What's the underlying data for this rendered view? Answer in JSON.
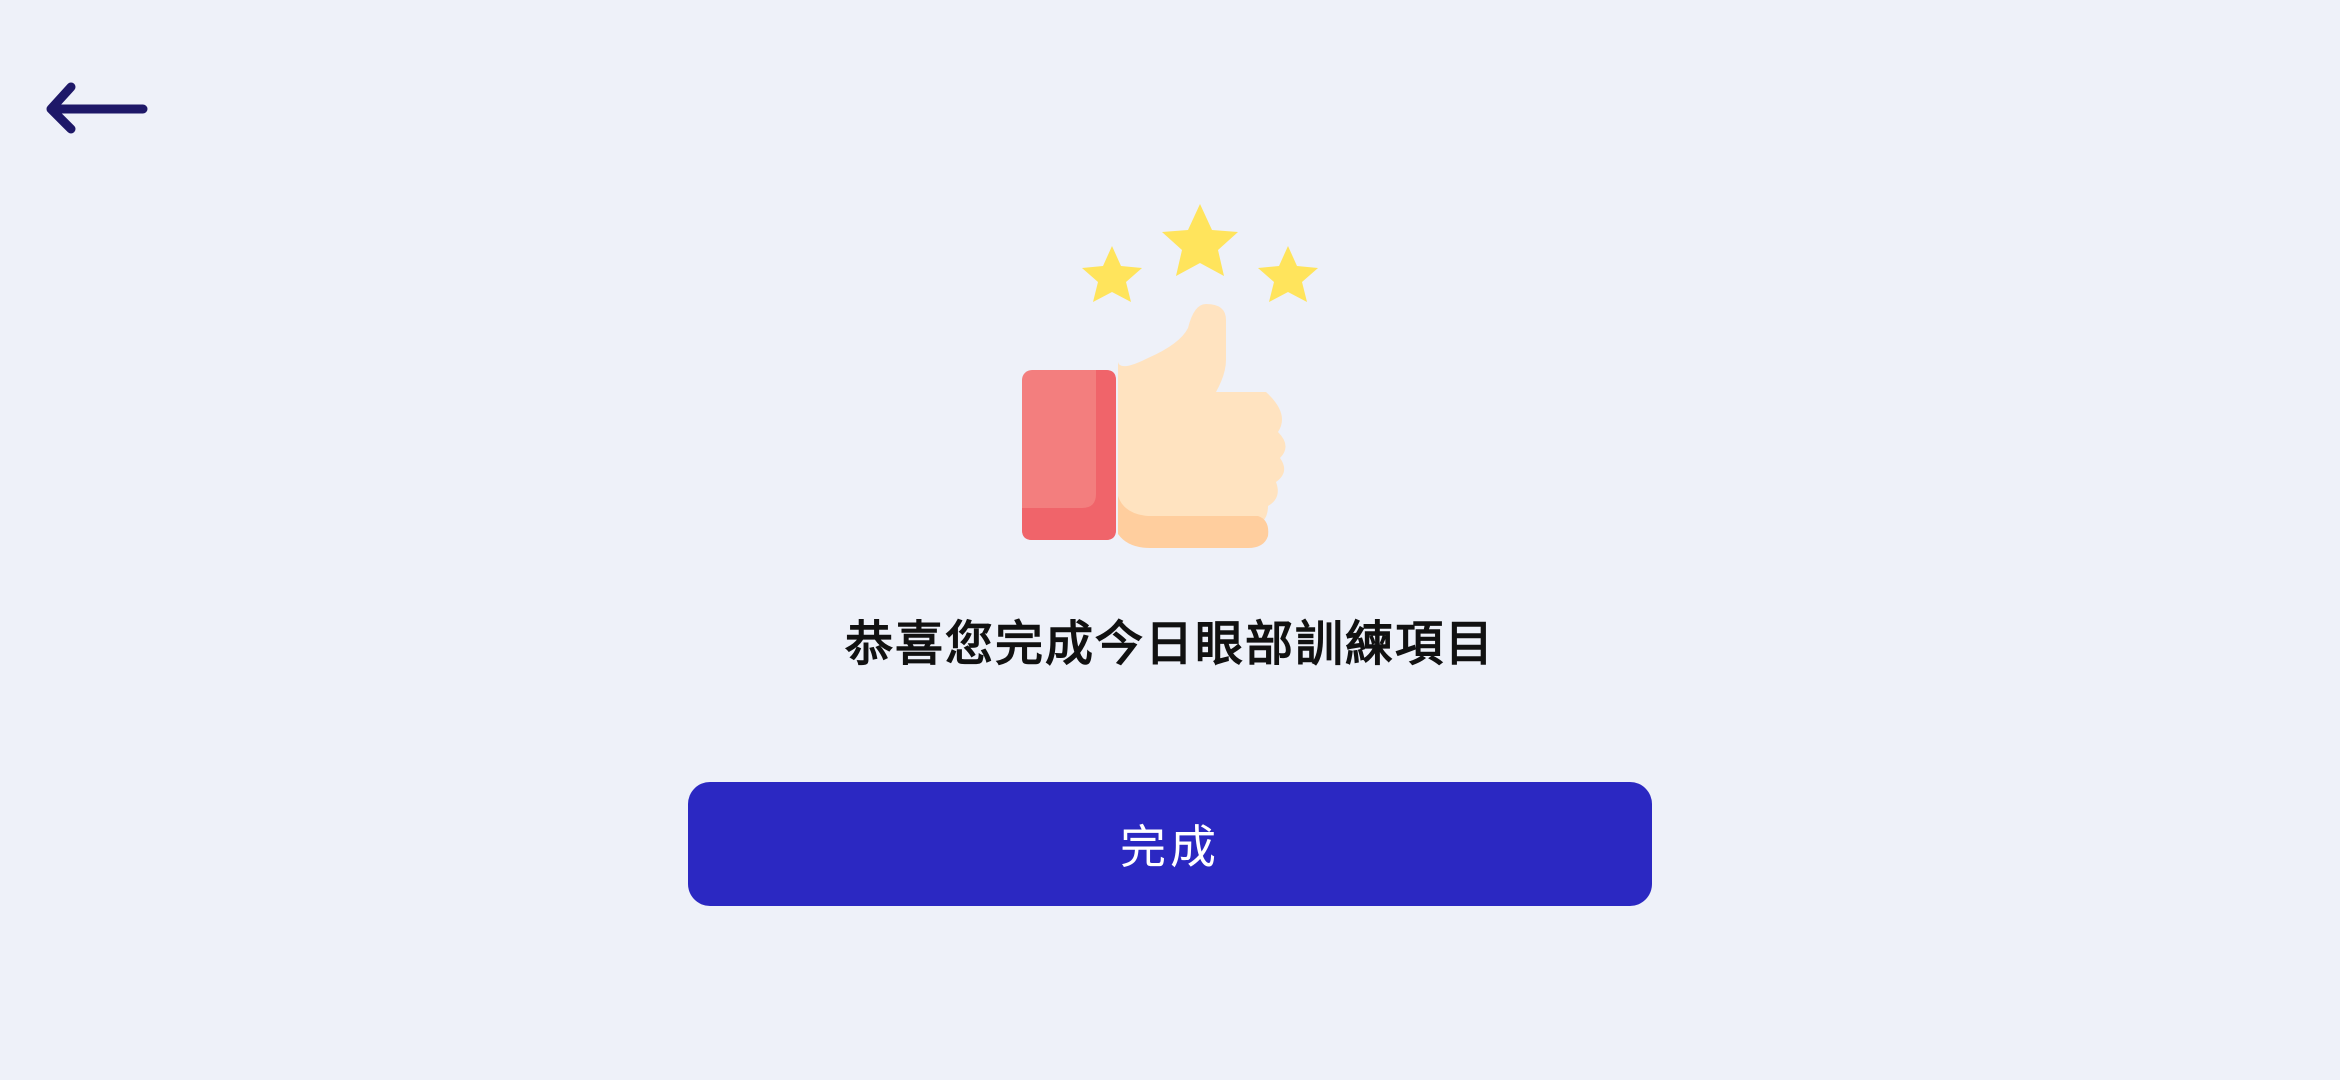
{
  "header": {
    "back_icon": "arrow-left-icon"
  },
  "illustration": {
    "icon": "thumbs-up-with-three-stars",
    "star_color": "#FFE45C",
    "cuff_color": "#F37E7E",
    "hand_color": "#FFE3C0"
  },
  "main": {
    "message": "恭喜您完成今日眼部訓練項目"
  },
  "footer": {
    "done_label": "完成",
    "done_color": "#2B28C2"
  },
  "theme": {
    "background": "#EEF1F9",
    "icon_color": "#1E1868"
  }
}
